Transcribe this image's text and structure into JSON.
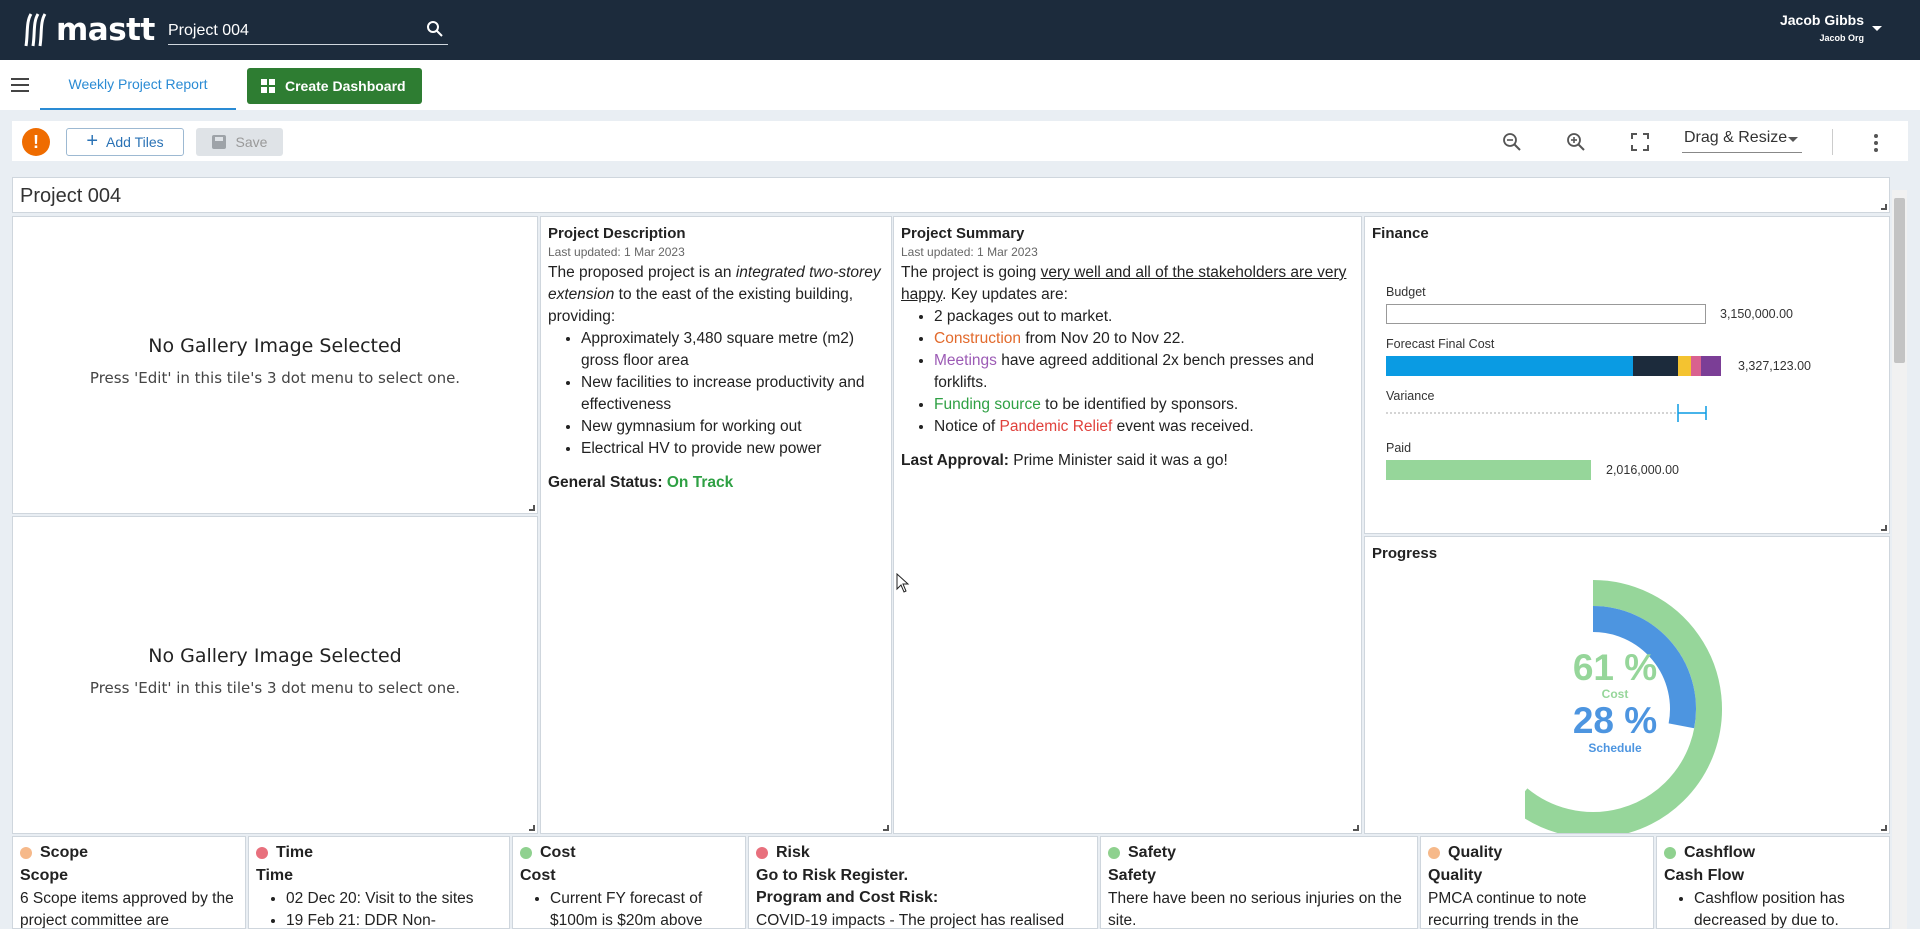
{
  "app": {
    "brand": "mastt",
    "project_name": "Project 004",
    "user": {
      "name": "Jacob Gibbs",
      "org": "Jacob Org"
    }
  },
  "nav": {
    "active_tab": "Weekly Project Report",
    "create_dashboard_label": "Create Dashboard"
  },
  "toolbar": {
    "alert_symbol": "!",
    "add_tiles_label": "Add Tiles",
    "save_label": "Save",
    "layout_mode": "Drag & Resize"
  },
  "dashboard": {
    "title": "Project 004",
    "gallery": {
      "heading": "No Gallery Image Selected",
      "hint": "Press 'Edit' in this tile's 3 dot menu to select one."
    },
    "description": {
      "title": "Project Description",
      "updated": "Last updated: 1 Mar 2023",
      "intro_before": "The proposed project is an ",
      "intro_em": "integrated two-storey extension",
      "intro_after": " to the east of the existing building, providing:",
      "bullets": [
        "Approximately 3,480 square metre (m2) gross floor area",
        "New facilities to increase productivity and effectiveness",
        "New gymnasium for working out",
        "Electrical HV to provide new power"
      ],
      "status_label": "General Status:",
      "status_value": "On Track"
    },
    "summary": {
      "title": "Project Summary",
      "updated": "Last updated: 1 Mar 2023",
      "intro_before": "The project is going ",
      "intro_u": "very well and all of the stakeholders are very happy",
      "intro_after": ". Key updates are:",
      "b1": "2 packages out to market.",
      "b2_hl": "Construction",
      "b2_rest": " from Nov 20 to Nov 22.",
      "b3_hl": "Meetings",
      "b3_rest": " have agreed additional 2x bench presses and forklifts.",
      "b4_hl": "Funding source",
      "b4_rest": " to be identified by sponsors.",
      "b5_pre": "Notice of ",
      "b5_hl": "Pandemic Relief",
      "b5_rest": " event was received.",
      "approval_label": "Last Approval:",
      "approval_text": " Prime Minister said it was a go!"
    },
    "finance": {
      "title": "Finance",
      "budget_label": "Budget",
      "budget_value": "3,150,000.00",
      "forecast_label": "Forecast Final Cost",
      "forecast_value": "3,327,123.00",
      "variance_label": "Variance",
      "paid_label": "Paid",
      "paid_value": "2,016,000.00",
      "colors": {
        "blue": "#0a9be3",
        "navy": "#1c2b3c",
        "yellow": "#f4c330",
        "pink": "#d9618f",
        "purple": "#7b3e96",
        "paid_green": "#96d69a"
      }
    },
    "progress": {
      "title": "Progress",
      "cost_value": "61 %",
      "cost_label": "Cost",
      "schedule_value": "28 %",
      "schedule_label": "Schedule",
      "cost_fraction": 0.61,
      "schedule_fraction": 0.28,
      "cost_color": "#96d69a",
      "schedule_color": "#4d95e0"
    },
    "bottom": [
      {
        "title": "Scope",
        "dot": "#f6b98a",
        "sub": "Scope",
        "text": "6 Scope items approved by the project committee are"
      },
      {
        "title": "Time",
        "dot": "#e8707d",
        "sub": "Time",
        "items": [
          "02 Dec 20: Visit to the sites",
          "19 Feb 21: DDR Non-"
        ]
      },
      {
        "title": "Cost",
        "dot": "#8fd18f",
        "sub": "Cost",
        "items": [
          "Current FY forecast of $100m is $20m above"
        ]
      },
      {
        "title": "Risk",
        "dot": "#e8707d",
        "sub": "Go to Risk Register.",
        "sub2": "Program and Cost Risk:",
        "text": "COVID-19 impacts - The project has realised"
      },
      {
        "title": "Safety",
        "dot": "#8fd18f",
        "sub": "Safety",
        "text": "There have been no serious injuries on the site."
      },
      {
        "title": "Quality",
        "dot": "#f6b98a",
        "sub": "Quality",
        "text": "PMCA continue to note recurring trends in the"
      },
      {
        "title": "Cashflow",
        "dot": "#8fd18f",
        "sub": "Cash Flow",
        "items": [
          "Cashflow position has decreased by due to."
        ]
      }
    ]
  }
}
